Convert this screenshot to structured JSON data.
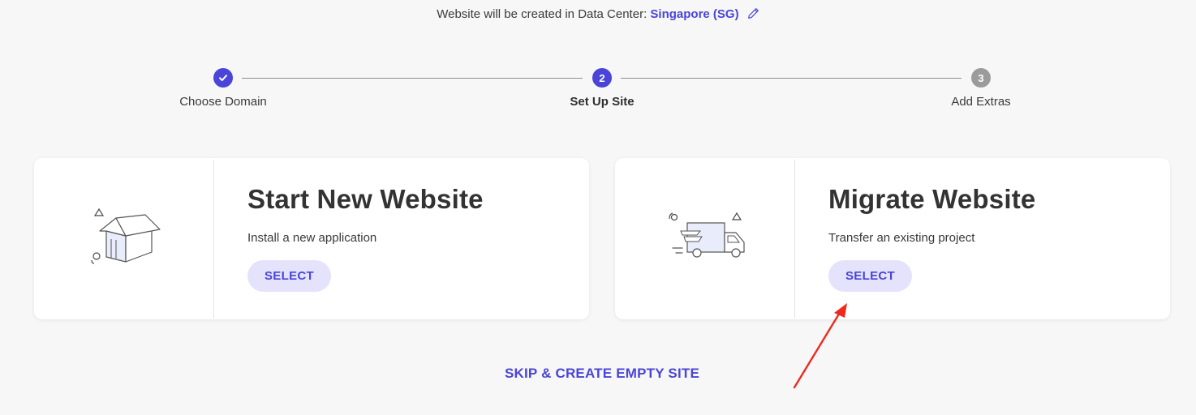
{
  "data_center": {
    "prefix": "Website will be created in Data Center:",
    "value": "Singapore (SG)",
    "edit_icon": "pencil-icon"
  },
  "stepper": {
    "steps": [
      {
        "label": "Choose Domain",
        "state": "done",
        "marker": "✓"
      },
      {
        "label": "Set Up Site",
        "state": "active",
        "marker": "2"
      },
      {
        "label": "Add Extras",
        "state": "pending",
        "marker": "3"
      }
    ]
  },
  "cards": {
    "new_site": {
      "title": "Start New Website",
      "description": "Install a new application",
      "button": "SELECT",
      "illustration": "house-box-icon"
    },
    "migrate": {
      "title": "Migrate Website",
      "description": "Transfer an existing project",
      "button": "SELECT",
      "illustration": "delivery-truck-icon"
    }
  },
  "skip_link": "SKIP & CREATE EMPTY SITE",
  "colors": {
    "accent": "#4a45d8",
    "button_bg": "#e4e3fb",
    "background": "#f7f7f7",
    "annotation_arrow": "#ee2a1f"
  }
}
